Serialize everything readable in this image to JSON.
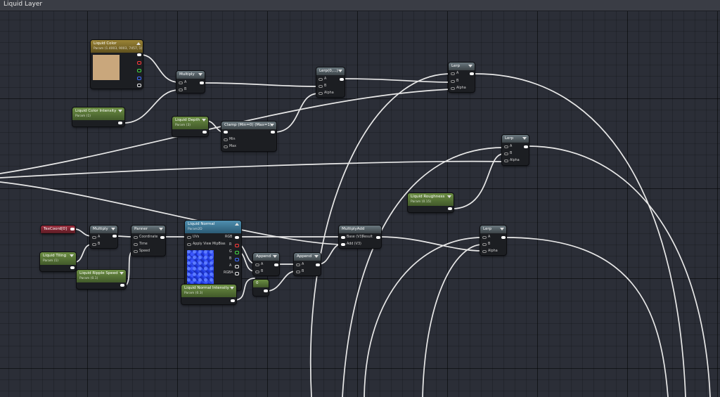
{
  "window": {
    "title": "Liquid Layer"
  },
  "colors": {
    "wire": "#e8e8e8",
    "graph_bg": "#2b2e37",
    "param_header": "#5a7a35",
    "texture_header": "#3f7fa5"
  },
  "nodes": {
    "liquid_color": {
      "title": "Liquid Color",
      "sub": "Param (1.4003, 9003, 7457, 1)"
    },
    "multiply_1": {
      "title": "Multiply",
      "pins": [
        "A",
        "B"
      ]
    },
    "liquid_color_intensity": {
      "title": "Liquid Color Intensity",
      "sub": "Param (1)"
    },
    "liquid_depth": {
      "title": "Liquid Depth",
      "sub": "Param (3)"
    },
    "clamp": {
      "title": "Clamp (Min=0) (Max=1)",
      "pins": [
        "Min",
        "Max"
      ]
    },
    "lerp_top_mid": {
      "title": "Lerp(0,...)",
      "pins": [
        "A",
        "B",
        "Alpha"
      ]
    },
    "lerp_top_right": {
      "title": "Lerp",
      "pins": [
        "A",
        "B",
        "Alpha"
      ]
    },
    "lerp_mid_right": {
      "title": "Lerp",
      "pins": [
        "A",
        "B",
        "Alpha"
      ]
    },
    "liquid_roughness": {
      "title": "Liquid Roughness",
      "sub": "Param (0.15)"
    },
    "texcoord": {
      "title": "TexCoord[0]"
    },
    "multiply_2": {
      "title": "Multiply",
      "pins": [
        "A",
        "B"
      ]
    },
    "liquid_tiling": {
      "title": "Liquid Tiling",
      "sub": "Param (1)"
    },
    "liquid_ripple_speed": {
      "title": "Liquid Ripple Speed",
      "sub": "Param (0.1)"
    },
    "panner": {
      "title": "Panner",
      "pins": [
        "Coordinate",
        "Time",
        "Speed"
      ]
    },
    "liquid_normal": {
      "title": "Liquid Normal",
      "sub": "Param2D",
      "inputs": [
        "UVs",
        "Apply View MipBias"
      ],
      "outputs": [
        "RGB",
        "R",
        "G",
        "B",
        "A",
        "RGBA"
      ]
    },
    "append_1": {
      "title": "Append",
      "pins": [
        "A",
        "B"
      ]
    },
    "append_2": {
      "title": "Append",
      "pins": [
        "A",
        "B"
      ]
    },
    "const_zero": {
      "title": "0"
    },
    "liquid_normal_intensity": {
      "title": "Liquid Normal Intensity",
      "sub": "Param (0.3)"
    },
    "multiply_add": {
      "title": "MultiplyAdd",
      "inputs": [
        "Base (V3)",
        "Add (V3)"
      ],
      "outputs": [
        "Result"
      ]
    },
    "lerp_bottom_right": {
      "title": "Lerp",
      "pins": [
        "A",
        "B",
        "Alpha"
      ]
    }
  }
}
